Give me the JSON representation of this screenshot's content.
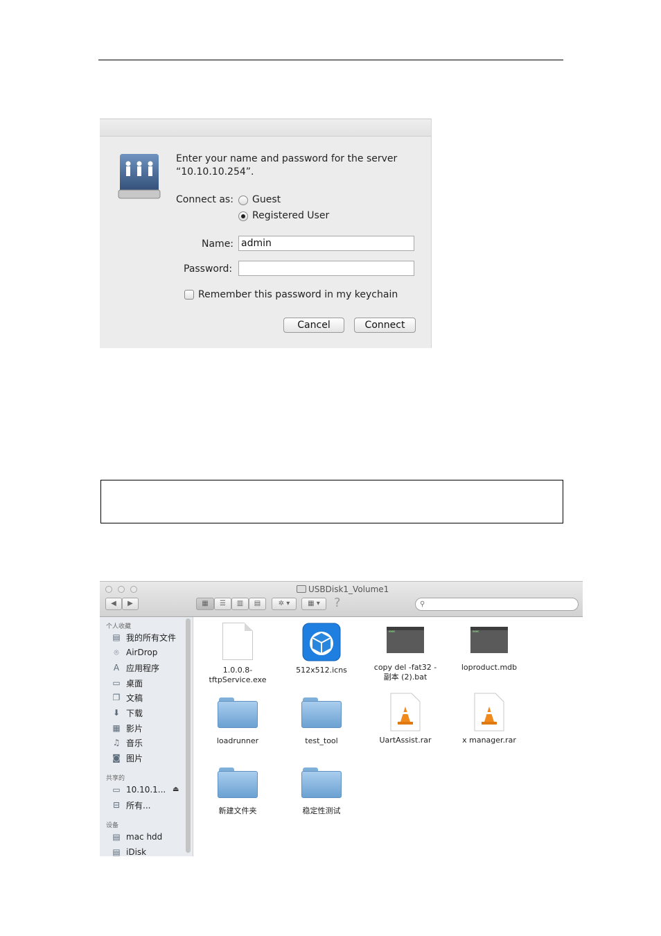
{
  "dialog": {
    "prompt_line1": "Enter your name and password for the server",
    "prompt_line2": "“10.10.10.254”.",
    "connect_as_label": "Connect as:",
    "option_guest": "Guest",
    "option_registered": "Registered User",
    "selected_option": "Registered User",
    "name_label": "Name:",
    "name_value": "admin",
    "password_label": "Password:",
    "password_value": "",
    "remember_label": "Remember this password in my keychain",
    "remember_checked": false,
    "cancel_label": "Cancel",
    "connect_label": "Connect"
  },
  "finder": {
    "window_title": "USBDisk1_Volume1",
    "help_label": "?",
    "sidebar": {
      "favorites_header": "个人收藏",
      "favorites": [
        {
          "label": "我的所有文件",
          "icon": "all-files-icon"
        },
        {
          "label": "AirDrop",
          "icon": "airdrop-icon"
        },
        {
          "label": "应用程序",
          "icon": "applications-icon"
        },
        {
          "label": "桌面",
          "icon": "desktop-icon"
        },
        {
          "label": "文稿",
          "icon": "documents-icon"
        },
        {
          "label": "下载",
          "icon": "downloads-icon"
        },
        {
          "label": "影片",
          "icon": "movies-icon"
        },
        {
          "label": "音乐",
          "icon": "music-icon"
        },
        {
          "label": "图片",
          "icon": "pictures-icon"
        }
      ],
      "shared_header": "共享的",
      "shared": [
        {
          "label": "10.10.1...",
          "icon": "server-icon"
        },
        {
          "label": "所有...",
          "icon": "network-icon"
        }
      ],
      "devices_header": "设备",
      "devices": [
        {
          "label": "mac hdd",
          "icon": "disk-icon"
        },
        {
          "label": "iDisk",
          "icon": "idisk-icon"
        }
      ]
    },
    "files": [
      {
        "line1": "1.0.0.8-",
        "line2": "tftpService.exe",
        "icon": "generic-document-icon"
      },
      {
        "line1": "512x512.icns",
        "line2": "",
        "icon": "app-cube-icon"
      },
      {
        "line1": "copy del -fat32 -",
        "line2": "副本 (2).bat",
        "icon": "terminal-icon"
      },
      {
        "line1": "loproduct.mdb",
        "line2": "",
        "icon": "terminal-icon"
      },
      {
        "line1": "loadrunner",
        "line2": "",
        "icon": "folder-icon"
      },
      {
        "line1": "test_tool",
        "line2": "",
        "icon": "folder-icon"
      },
      {
        "line1": "UartAssist.rar",
        "line2": "",
        "icon": "vlc-cone-icon"
      },
      {
        "line1": "x manager.rar",
        "line2": "",
        "icon": "vlc-cone-icon"
      },
      {
        "line1": "新建文件夹",
        "line2": "",
        "icon": "folder-icon"
      },
      {
        "line1": "稳定性测试",
        "line2": "",
        "icon": "folder-icon"
      }
    ]
  }
}
